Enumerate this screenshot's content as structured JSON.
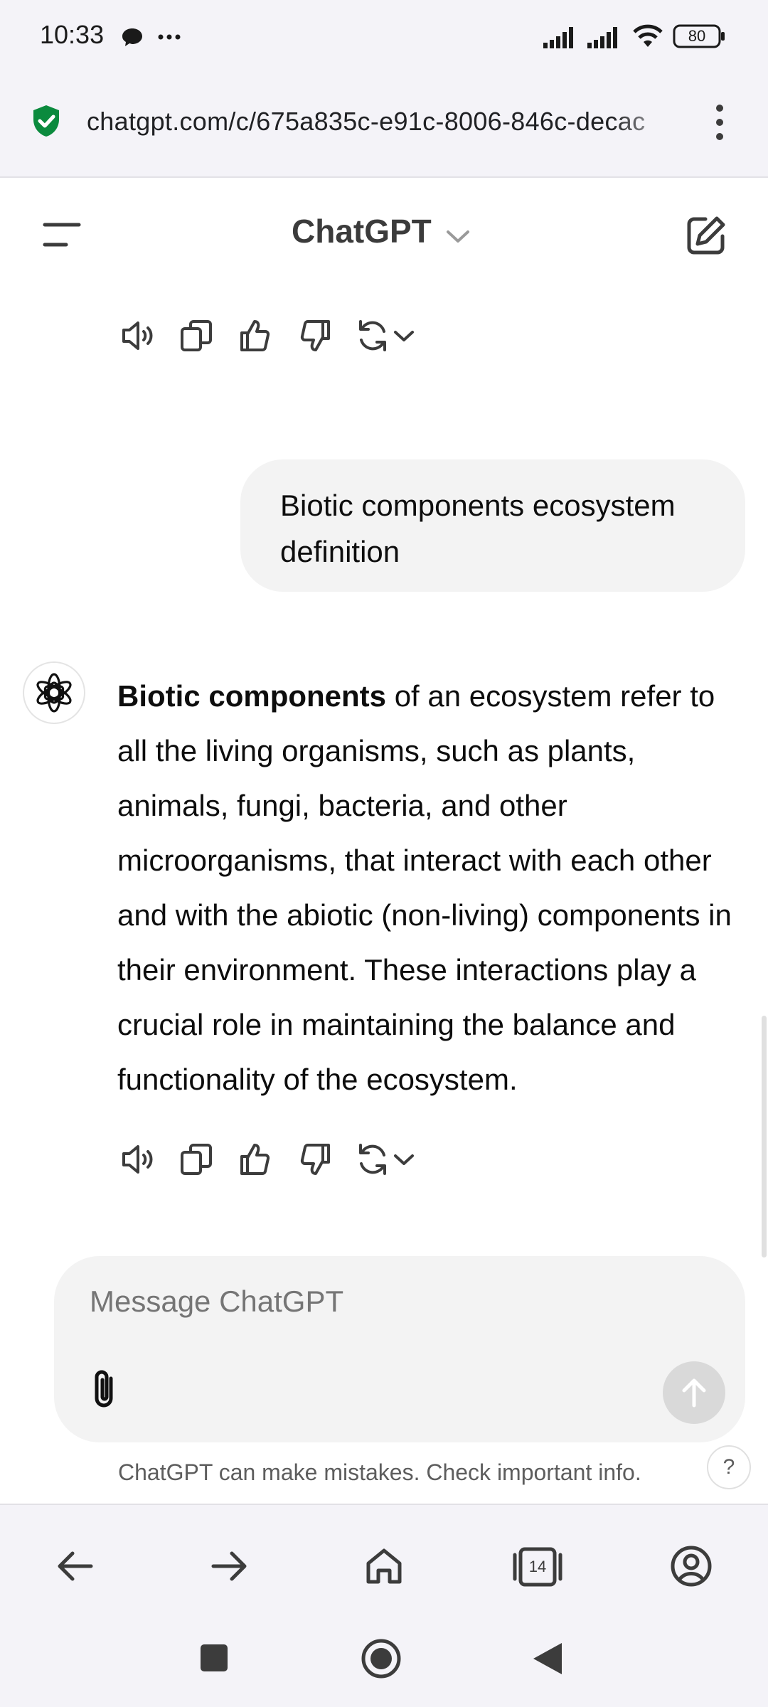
{
  "status_bar": {
    "time": "10:33",
    "battery": "80",
    "icons": [
      "chat-bubble-icon",
      "more-dots-icon",
      "signal-icon",
      "signal-icon",
      "wifi-icon",
      "battery-icon"
    ]
  },
  "url_bar": {
    "url": "chatgpt.com/c/675a835c-e91c-8006-846c-decac",
    "secure_icon": "shield-check-icon",
    "menu_icon": "kebab-menu-icon",
    "secure_color": "#0b8a3e"
  },
  "header": {
    "title": "ChatGPT",
    "menu_icon": "hamburger-icon",
    "new_chat_icon": "edit-icon",
    "dropdown_icon": "chevron-down-icon"
  },
  "messages": {
    "user": {
      "text": "Biotic components ecosystem definition"
    },
    "assistant": {
      "bold_lead": "Biotic components",
      "text": " of an ecosystem refer to all the living organisms, such as plants, animals, fungi, bacteria, and other microorganisms, that interact with each other and with the abiotic (non-living) components in their environment. These interactions play a crucial role in maintaining the balance and functionality of the ecosystem."
    },
    "actions": [
      "speaker-icon",
      "copy-icon",
      "thumbs-up-icon",
      "thumbs-down-icon",
      "regenerate-icon",
      "chevron-down-icon"
    ]
  },
  "composer": {
    "placeholder": "Message ChatGPT",
    "value": "",
    "attach_icon": "paperclip-icon",
    "send_icon": "arrow-up-icon"
  },
  "footer": {
    "disclaimer": "ChatGPT can make mistakes. Check important info.",
    "help_label": "?"
  },
  "browser_toolbar": {
    "tab_count": "14",
    "icons": [
      "back-arrow-icon",
      "forward-arrow-icon",
      "home-icon",
      "tabs-icon",
      "account-icon"
    ]
  },
  "system_nav": {
    "icons": [
      "recent-apps-icon",
      "home-circle-icon",
      "back-triangle-icon"
    ]
  }
}
